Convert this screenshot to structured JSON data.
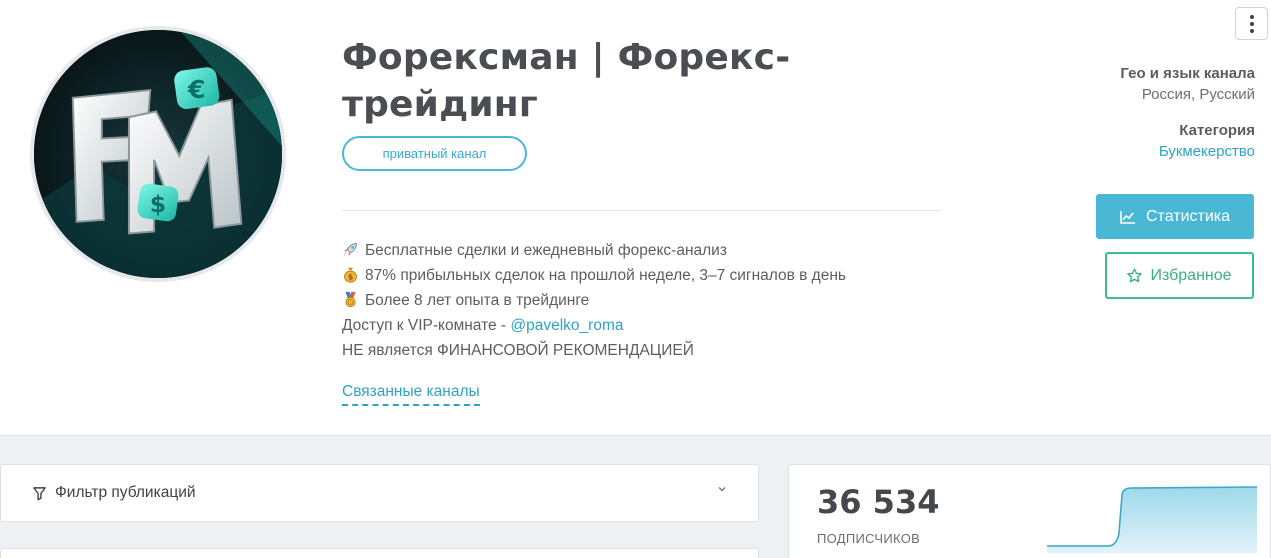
{
  "channel": {
    "title": "Форексман | Форекс-трейдинг",
    "badge": "приватный канал",
    "avatar_icon": "forexman-logo-avatar",
    "description": [
      {
        "emoji": "rocket-emoji",
        "text": "Бесплатные сделки и ежедневный форекс-анализ"
      },
      {
        "emoji": "money-bag-emoji",
        "text": "87% прибыльных сделок на прошлой неделе, 3–7 сигналов в день"
      },
      {
        "emoji": "medal-emoji",
        "text": "Более 8 лет опыта в трейдинге"
      }
    ],
    "vip_prefix": "Доступ к VIP-комнате - ",
    "vip_handle": "@pavelko_roma",
    "disclaimer": "НЕ является ФИНАНСОВОЙ РЕКОМЕНДАЦИЕЙ",
    "related_link": "Связанные каналы"
  },
  "meta": {
    "geo_label": "Гео и язык канала",
    "geo_value": "Россия, Русский",
    "category_label": "Категория",
    "category_value": "Букмекерство"
  },
  "actions": {
    "stats_label": "Статистика",
    "favorite_label": "Избранное",
    "more_icon": "vertical-dots-icon"
  },
  "filter": {
    "label": "Фильтр публикаций"
  },
  "subscribers": {
    "count": "36 534",
    "label": "подписчиков"
  },
  "colors": {
    "accent_blue": "#4ab7d4",
    "accent_green": "#3cc08a",
    "link_blue": "#2fa3c4"
  }
}
